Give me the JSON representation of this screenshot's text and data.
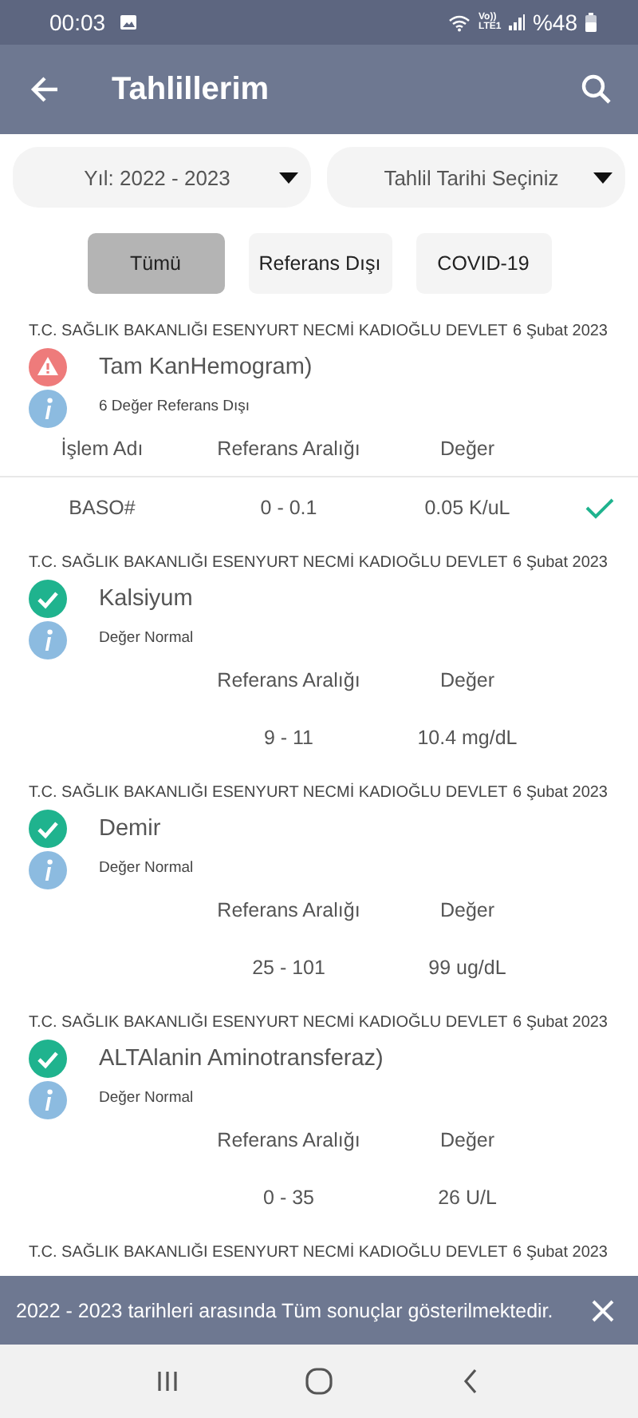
{
  "status_bar": {
    "time": "00:03",
    "network": "Vo)) LTE1",
    "battery": "%48"
  },
  "app_bar": {
    "title": "Tahlillerim"
  },
  "filters": [
    {
      "label": "Yıl: 2022 - 2023"
    },
    {
      "label": "Tahlil Tarihi Seçiniz"
    }
  ],
  "chips": [
    {
      "label": "Tümü",
      "selected": true
    },
    {
      "label": "Referans Dışı",
      "selected": false
    },
    {
      "label": "COVID-19",
      "selected": false
    }
  ],
  "results": [
    {
      "kind": "abnormal",
      "hospital": "T.C. SAĞLIK BAKANLIĞI ESENYURT NECMİ KADIOĞLU DEVLET",
      "date": "6 Şubat 2023",
      "title": "Tam KanHemogram)",
      "info": "6 Değer Referans Dışı",
      "columns": [
        "İşlem Adı",
        "Referans Aralığı",
        "Değer"
      ],
      "rows": [
        {
          "name": "BASO#",
          "range": "0 - 0.1",
          "value": "0.05 K/uL",
          "normal": true
        }
      ]
    },
    {
      "kind": "normal",
      "hospital": "T.C. SAĞLIK BAKANLIĞI ESENYURT NECMİ KADIOĞLU DEVLET",
      "date": "6 Şubat 2023",
      "title": "Kalsiyum",
      "info": "Değer Normal",
      "columns": [
        "Referans Aralığı",
        "Değer"
      ],
      "rows": [
        {
          "range": "9 - 11",
          "value": "10.4 mg/dL"
        }
      ]
    },
    {
      "kind": "normal",
      "hospital": "T.C. SAĞLIK BAKANLIĞI ESENYURT NECMİ KADIOĞLU DEVLET",
      "date": "6 Şubat 2023",
      "title": "Demir",
      "info": "Değer Normal",
      "columns": [
        "Referans Aralığı",
        "Değer"
      ],
      "rows": [
        {
          "range": "25 - 101",
          "value": "99 ug/dL"
        }
      ]
    },
    {
      "kind": "normal",
      "hospital": "T.C. SAĞLIK BAKANLIĞI ESENYURT NECMİ KADIOĞLU DEVLET",
      "date": "6 Şubat 2023",
      "title": "ALTAlanin Aminotransferaz)",
      "info": "Değer Normal",
      "columns": [
        "Referans Aralığı",
        "Değer"
      ],
      "rows": [
        {
          "range": "0 - 35",
          "value": "26 U/L"
        }
      ]
    },
    {
      "kind": "partial",
      "hospital": "T.C. SAĞLIK BAKANLIĞI ESENYURT NECMİ KADIOĞLU DEVLET",
      "date": "6 Şubat 2023"
    }
  ],
  "snackbar": {
    "message": "2022 - 2023 tarihleri arasında Tüm sonuçlar gösterilmektedir."
  }
}
